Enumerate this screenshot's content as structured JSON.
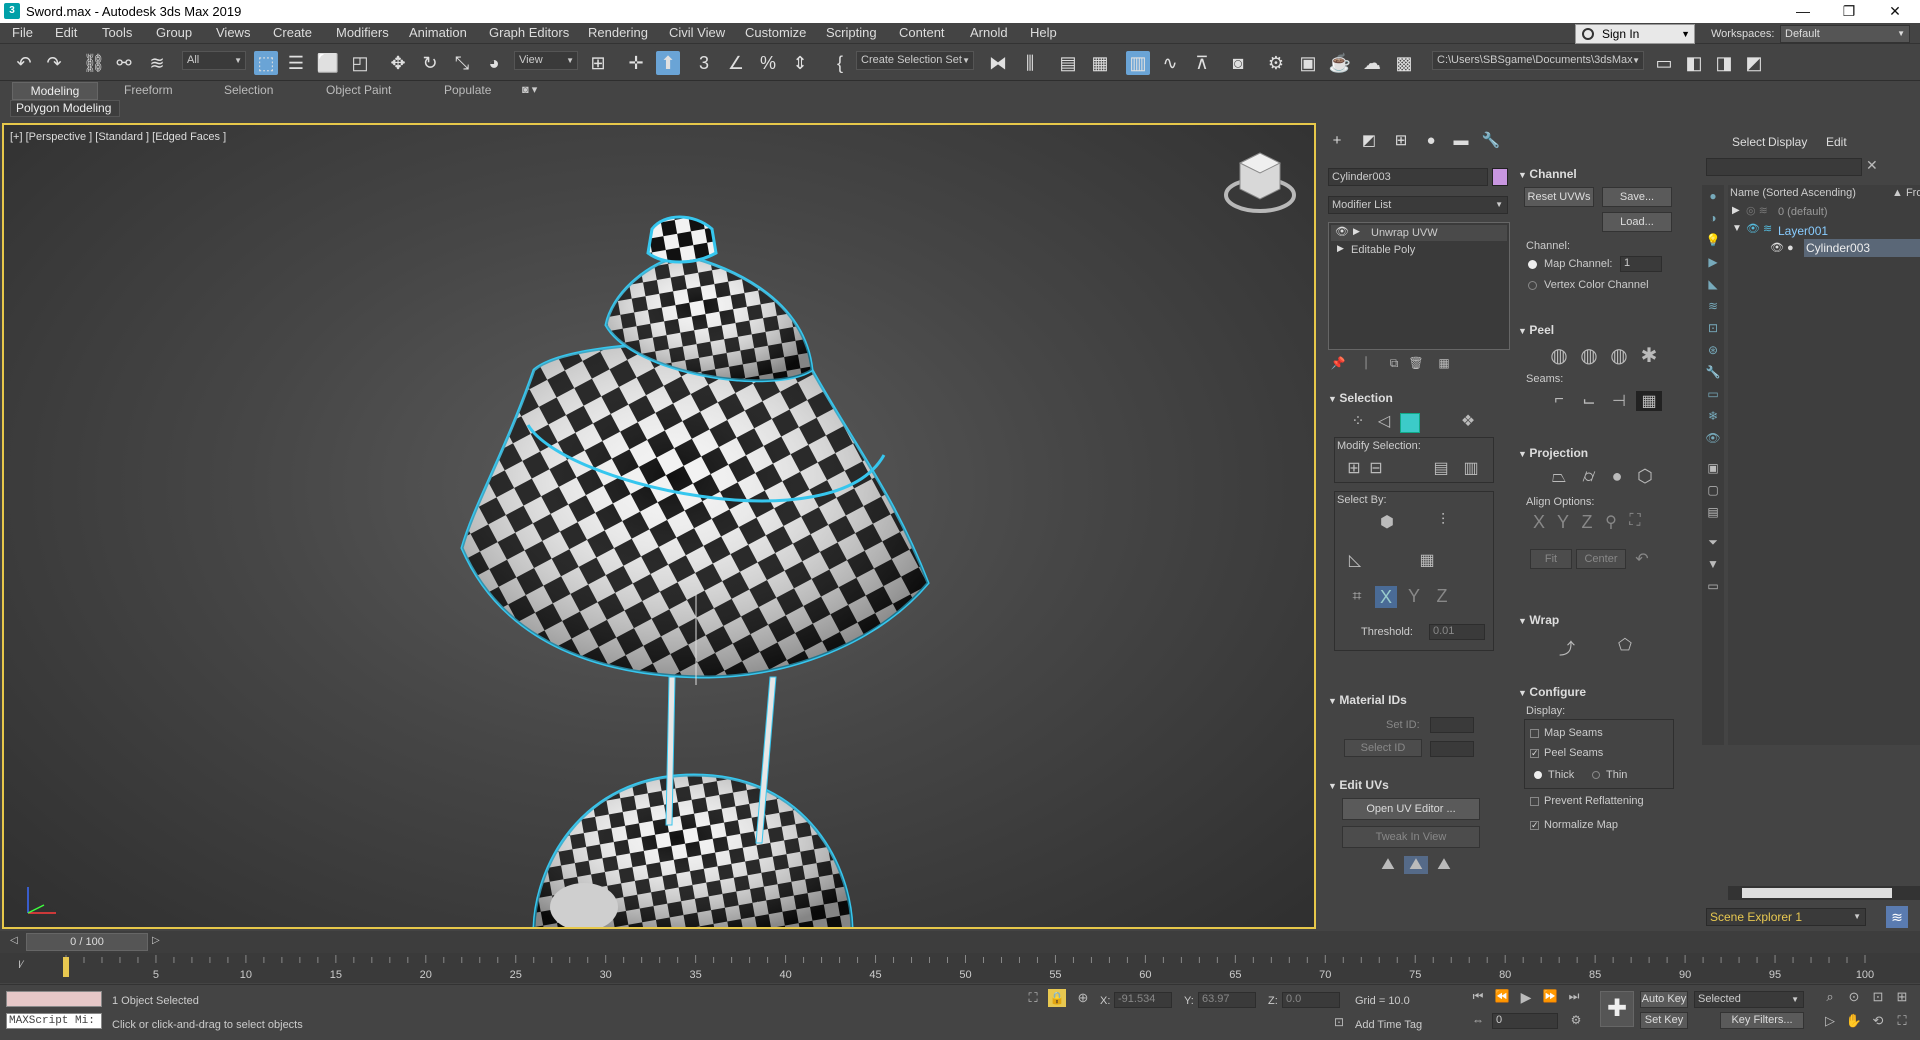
{
  "title_bar": {
    "title": "Sword.max - Autodesk 3ds Max 2019",
    "minimize": "—",
    "maximize": "❐",
    "close": "✕"
  },
  "menu": [
    "File",
    "Edit",
    "Tools",
    "Group",
    "Views",
    "Create",
    "Modifiers",
    "Animation",
    "Graph Editors",
    "Rendering",
    "Civil View",
    "Customize",
    "Scripting",
    "Content",
    "Arnold",
    "Help"
  ],
  "account": {
    "sign_in": "Sign In",
    "workspaces_label": "Workspaces:",
    "workspace": "Default"
  },
  "toolbar": {
    "selection_filter": "All",
    "view_coord": "View",
    "selection_set": "Create Selection Set",
    "project_path": "C:\\Users\\SBSgame\\Documents\\3dsMax"
  },
  "ribbon": {
    "tabs": [
      "Modeling",
      "Freeform",
      "Selection",
      "Object Paint",
      "Populate"
    ],
    "panel": "Polygon Modeling"
  },
  "viewport": {
    "label": "[+] [Perspective ] [Standard ] [Edged Faces ]"
  },
  "command_panel": {
    "object_name": "Cylinder003",
    "object_color": "#c896e0",
    "modifier_list": "Modifier List",
    "stack": [
      "Unwrap UVW",
      "Editable Poly"
    ],
    "selection": {
      "title": "Selection",
      "modify_selection": "Modify Selection:",
      "select_by": "Select By:",
      "threshold_label": "Threshold:",
      "threshold_value": "0.01"
    },
    "material_ids": {
      "title": "Material IDs",
      "set_id": "Set ID:",
      "select_id": "Select ID"
    },
    "edit_uvs": {
      "title": "Edit UVs",
      "open_uv_editor": "Open UV Editor ...",
      "tweak_in_view": "Tweak In View"
    },
    "channel": {
      "title": "Channel",
      "reset_uvws": "Reset UVWs",
      "save": "Save...",
      "load": "Load...",
      "channel_label": "Channel:",
      "map_channel": "Map Channel:",
      "map_channel_value": "1",
      "vertex_color_channel": "Vertex Color Channel"
    },
    "peel": {
      "title": "Peel",
      "seams": "Seams:"
    },
    "projection": {
      "title": "Projection",
      "align_options": "Align Options:",
      "x": "X",
      "y": "Y",
      "z": "Z",
      "fit": "Fit",
      "center": "Center"
    },
    "wrap": {
      "title": "Wrap"
    },
    "configure": {
      "title": "Configure",
      "display": "Display:",
      "map_seams": "Map Seams",
      "peel_seams": "Peel Seams",
      "thick": "Thick",
      "thin": "Thin",
      "prevent_reflattening": "Prevent Reflattening",
      "normalize_map": "Normalize Map"
    }
  },
  "scene_explorer": {
    "tabs": [
      "Select",
      "Display",
      "Edit"
    ],
    "column_name": "Name (Sorted Ascending)",
    "column_frozen": "▲ Fro",
    "items": [
      "0 (default)",
      "Layer001",
      "Cylinder003"
    ],
    "footer": "Scene Explorer 1"
  },
  "timeline": {
    "frame": "0 / 100",
    "ticks": [
      "5",
      "10",
      "15",
      "20",
      "25",
      "30",
      "35",
      "40",
      "45",
      "50",
      "55",
      "60",
      "65",
      "70",
      "75",
      "80",
      "85",
      "90",
      "95",
      "100"
    ],
    "current": 0,
    "total": 100
  },
  "status": {
    "maxscript": "MAXScript Mi:",
    "selected": "1 Object Selected",
    "prompt": "Click or click-and-drag to select objects",
    "x_label": "X:",
    "x": "-91.534",
    "y_label": "Y:",
    "y": "63.97",
    "z_label": "Z:",
    "z": "0.0",
    "grid": "Grid = 10.0",
    "add_time_tag": "Add Time Tag",
    "auto_key": "Auto Key",
    "set_key": "Set Key",
    "key_mode": "Selected",
    "key_filters": "Key Filters...",
    "frame_value": "0"
  }
}
